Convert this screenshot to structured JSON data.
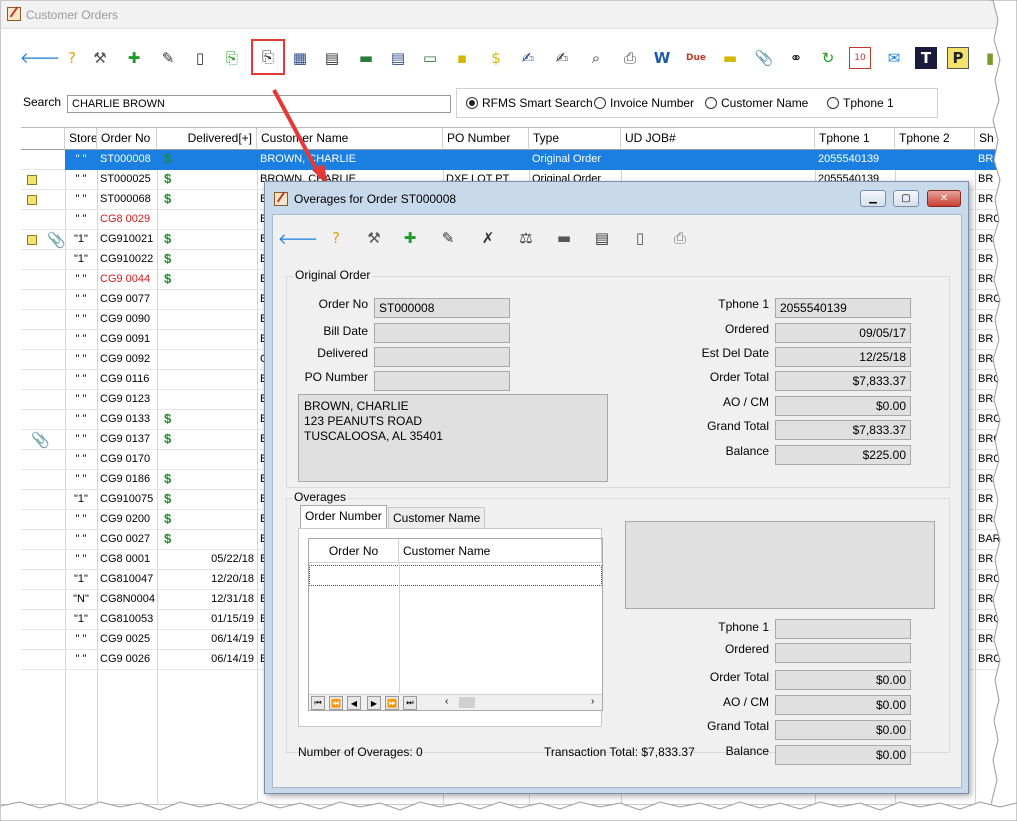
{
  "window": {
    "title": "Customer Orders"
  },
  "toolbar": {
    "items": [
      {
        "name": "back-arrow-icon",
        "glyph": "🡐",
        "color": "#1a7fe0"
      },
      {
        "name": "help-icon",
        "glyph": "?",
        "color": "#e2a400"
      },
      {
        "name": "tools-icon",
        "glyph": "⚒",
        "color": "#555555"
      },
      {
        "name": "add-document-icon",
        "glyph": "✚",
        "color": "#1e9c2a"
      },
      {
        "name": "edit-document-icon",
        "glyph": "✎",
        "color": "#333333"
      },
      {
        "name": "document-icon",
        "glyph": "▯",
        "color": "#333333"
      },
      {
        "name": "copy-add-icon",
        "glyph": "⎘",
        "color": "#1e9c2a"
      },
      {
        "name": "overages-icon",
        "glyph": "⎘",
        "color": "#333333"
      },
      {
        "name": "calculator-icon",
        "glyph": "▦",
        "color": "#2a4a8a"
      },
      {
        "name": "register-icon",
        "glyph": "▤",
        "color": "#333333"
      },
      {
        "name": "money-icon",
        "glyph": "▬",
        "color": "#2a7a3a"
      },
      {
        "name": "report-icon",
        "glyph": "▤",
        "color": "#2a4a8a"
      },
      {
        "name": "credit-card-icon",
        "glyph": "▭",
        "color": "#2a7a3a"
      },
      {
        "name": "note-icon",
        "glyph": "▪",
        "color": "#d4b800"
      },
      {
        "name": "dollar-note-icon",
        "glyph": "$",
        "color": "#d4b800"
      },
      {
        "name": "contract-icon",
        "glyph": "✍",
        "color": "#2a4a8a"
      },
      {
        "name": "signature-icon",
        "glyph": "✍",
        "color": "#333333"
      },
      {
        "name": "preview-icon",
        "glyph": "⌕",
        "color": "#333333"
      },
      {
        "name": "printer-icon",
        "glyph": "⎙",
        "color": "#555555"
      },
      {
        "name": "word-icon",
        "glyph": "W",
        "color": "#1e5aa8"
      },
      {
        "name": "due-icon",
        "glyph": "Due",
        "color": "#c0392b"
      },
      {
        "name": "ticket-icon",
        "glyph": "▬",
        "color": "#d4b800"
      },
      {
        "name": "paperclip-icon",
        "glyph": "📎",
        "color": "#555555"
      },
      {
        "name": "binoculars-icon",
        "glyph": "⚭",
        "color": "#222222"
      },
      {
        "name": "refresh-icon",
        "glyph": "↻",
        "color": "#1e9c2a"
      },
      {
        "name": "calendar-icon",
        "glyph": "10",
        "color": "#c0392b"
      },
      {
        "name": "email-icon",
        "glyph": "✉",
        "color": "#1a7fe0"
      },
      {
        "name": "t-icon",
        "glyph": "T",
        "color": "#ffffff"
      },
      {
        "name": "p-icon",
        "glyph": "P",
        "color": "#222222"
      },
      {
        "name": "book-icon",
        "glyph": "▮",
        "color": "#7a9a2a"
      }
    ]
  },
  "search": {
    "label": "Search",
    "value": "CHARLIE BROWN",
    "options": [
      {
        "label": "RFMS Smart Search",
        "selected": true
      },
      {
        "label": "Invoice Number",
        "selected": false
      },
      {
        "label": "Customer Name",
        "selected": false
      },
      {
        "label": "Tphone 1",
        "selected": false
      }
    ]
  },
  "grid": {
    "columns": [
      "Store",
      "Order No",
      "Delivered[+]",
      "Customer Name",
      "PO Number",
      "Type",
      "UD JOB#",
      "Tphone 1",
      "Tphone 2",
      "Sh"
    ],
    "rows": [
      {
        "icons": [],
        "store": "\" \"",
        "order": "ST000008",
        "dollar": "$",
        "delivered": "",
        "customer": "BROWN, CHARLIE",
        "po": "",
        "type": "Original Order",
        "tphone": "2055540139",
        "sh": "BR",
        "red": false,
        "selected": true
      },
      {
        "icons": [
          "note"
        ],
        "store": "\" \"",
        "order": "ST000025",
        "dollar": "$",
        "delivered": "",
        "customer": "BROWN, CHARLIE",
        "po": "DXF LOT PT",
        "type": "Original Order",
        "tphone": "2055540139",
        "sh": "BR",
        "red": false,
        "selected": false
      },
      {
        "icons": [
          "note"
        ],
        "store": "\" \"",
        "order": "ST000068",
        "dollar": "$",
        "delivered": "",
        "customer": "B",
        "po": "",
        "type": "",
        "tphone": "",
        "sh": "BR",
        "red": false,
        "selected": false
      },
      {
        "icons": [],
        "store": "\" \"",
        "order": "CG8 0029",
        "dollar": "",
        "delivered": "",
        "customer": "B",
        "po": "",
        "type": "",
        "tphone": "",
        "sh": "BRO",
        "red": true,
        "selected": false
      },
      {
        "icons": [
          "note",
          "clip"
        ],
        "store": "\"1\"",
        "order": "CG910021",
        "dollar": "$",
        "delivered": "",
        "customer": "B",
        "po": "",
        "type": "",
        "tphone": "",
        "sh": "BRO",
        "red": false,
        "selected": false
      },
      {
        "icons": [],
        "store": "\"1\"",
        "order": "CG910022",
        "dollar": "$",
        "delivered": "",
        "customer": "B",
        "po": "",
        "type": "",
        "tphone": "",
        "sh": "BR",
        "red": false,
        "selected": false
      },
      {
        "icons": [],
        "store": "\" \"",
        "order": "CG9 0044",
        "dollar": "$",
        "delivered": "",
        "customer": "B",
        "po": "",
        "type": "",
        "tphone": "",
        "sh": "BRO",
        "red": true,
        "selected": false
      },
      {
        "icons": [],
        "store": "\" \"",
        "order": "CG9 0077",
        "dollar": "",
        "delivered": "",
        "customer": "B",
        "po": "",
        "type": "",
        "tphone": "",
        "sh": "BRO",
        "red": false,
        "selected": false
      },
      {
        "icons": [],
        "store": "\" \"",
        "order": "CG9 0090",
        "dollar": "",
        "delivered": "",
        "customer": "B",
        "po": "",
        "type": "",
        "tphone": "",
        "sh": "BR",
        "red": false,
        "selected": false
      },
      {
        "icons": [],
        "store": "\" \"",
        "order": "CG9 0091",
        "dollar": "",
        "delivered": "",
        "customer": "B",
        "po": "",
        "type": "",
        "tphone": "",
        "sh": "BR",
        "red": false,
        "selected": false
      },
      {
        "icons": [],
        "store": "\" \"",
        "order": "CG9 0092",
        "dollar": "",
        "delivered": "",
        "customer": "C",
        "po": "",
        "type": "",
        "tphone": "",
        "sh": "BR",
        "red": false,
        "selected": false
      },
      {
        "icons": [],
        "store": "\" \"",
        "order": "CG9 0116",
        "dollar": "",
        "delivered": "",
        "customer": "B",
        "po": "",
        "type": "",
        "tphone": "",
        "sh": "BRO",
        "red": false,
        "selected": false
      },
      {
        "icons": [],
        "store": "\" \"",
        "order": "CG9 0123",
        "dollar": "",
        "delivered": "",
        "customer": "B",
        "po": "",
        "type": "",
        "tphone": "",
        "sh": "BRO",
        "red": false,
        "selected": false
      },
      {
        "icons": [],
        "store": "\" \"",
        "order": "CG9 0133",
        "dollar": "$",
        "delivered": "",
        "customer": "B",
        "po": "",
        "type": "",
        "tphone": "",
        "sh": "BRO",
        "red": false,
        "selected": false
      },
      {
        "icons": [
          "clip"
        ],
        "store": "\" \"",
        "order": "CG9 0137",
        "dollar": "$",
        "delivered": "",
        "customer": "B",
        "po": "",
        "type": "",
        "tphone": "",
        "sh": "BRO",
        "red": false,
        "selected": false
      },
      {
        "icons": [],
        "store": "\" \"",
        "order": "CG9 0170",
        "dollar": "",
        "delivered": "",
        "customer": "B",
        "po": "",
        "type": "",
        "tphone": "",
        "sh": "BRO",
        "red": false,
        "selected": false
      },
      {
        "icons": [],
        "store": "\" \"",
        "order": "CG9 0186",
        "dollar": "$",
        "delivered": "",
        "customer": "B",
        "po": "",
        "type": "",
        "tphone": "",
        "sh": "BRO",
        "red": false,
        "selected": false
      },
      {
        "icons": [],
        "store": "\"1\"",
        "order": "CG910075",
        "dollar": "$",
        "delivered": "",
        "customer": "B",
        "po": "",
        "type": "",
        "tphone": "",
        "sh": "BR",
        "red": false,
        "selected": false
      },
      {
        "icons": [],
        "store": "\" \"",
        "order": "CG9 0200",
        "dollar": "$",
        "delivered": "",
        "customer": "B",
        "po": "",
        "type": "",
        "tphone": "",
        "sh": "BRO",
        "red": false,
        "selected": false
      },
      {
        "icons": [],
        "store": "\" \"",
        "order": "CG0 0027",
        "dollar": "$",
        "delivered": "",
        "customer": "B",
        "po": "",
        "type": "",
        "tphone": "",
        "sh": "BAR",
        "red": false,
        "selected": false
      },
      {
        "icons": [],
        "store": "\" \"",
        "order": "CG8 0001",
        "dollar": "",
        "delivered": "05/22/18",
        "customer": "B",
        "po": "",
        "type": "",
        "tphone": "",
        "sh": "BR",
        "red": false,
        "selected": false
      },
      {
        "icons": [],
        "store": "\"1\"",
        "order": "CG810047",
        "dollar": "",
        "delivered": "12/20/18",
        "customer": "B",
        "po": "",
        "type": "",
        "tphone": "",
        "sh": "BRO",
        "red": false,
        "selected": false
      },
      {
        "icons": [],
        "store": "\"N\"",
        "order": "CG8N0004",
        "dollar": "",
        "delivered": "12/31/18",
        "customer": "B",
        "po": "",
        "type": "",
        "tphone": "",
        "sh": "BRO",
        "red": false,
        "selected": false
      },
      {
        "icons": [],
        "store": "\"1\"",
        "order": "CG810053",
        "dollar": "",
        "delivered": "01/15/19",
        "customer": "B",
        "po": "",
        "type": "",
        "tphone": "",
        "sh": "BRO",
        "red": false,
        "selected": false
      },
      {
        "icons": [],
        "store": "\" \"",
        "order": "CG9 0025",
        "dollar": "",
        "delivered": "06/14/19",
        "customer": "B",
        "po": "",
        "type": "",
        "tphone": "",
        "sh": "BRO",
        "red": false,
        "selected": false
      },
      {
        "icons": [],
        "store": "\" \"",
        "order": "CG9 0026",
        "dollar": "",
        "delivered": "06/14/19",
        "customer": "B",
        "po": "",
        "type": "",
        "tphone": "",
        "sh": "BRO",
        "red": false,
        "selected": false
      }
    ]
  },
  "dialog": {
    "title": "Overages for Order ST000008",
    "toolbar": [
      "back-arrow-icon",
      "help-icon",
      "tools-icon",
      "add-document-icon",
      "edit-document-icon",
      "delete-document-icon",
      "scale-icon",
      "money-icon",
      "report-icon",
      "document-icon",
      "printer-icon"
    ],
    "original_order": {
      "group_label": "Original Order",
      "order_no_label": "Order No",
      "order_no": "ST000008",
      "bill_date_label": "Bill Date",
      "bill_date": "",
      "delivered_label": "Delivered",
      "delivered": "",
      "po_number_label": "PO Number",
      "po_number": "",
      "address": [
        "BROWN, CHARLIE",
        "123 PEANUTS ROAD",
        "TUSCALOOSA, AL  35401"
      ],
      "tphone1_label": "Tphone 1",
      "tphone1": "2055540139",
      "ordered_label": "Ordered",
      "ordered": "09/05/17",
      "est_del_label": "Est Del Date",
      "est_del": "12/25/18",
      "order_total_label": "Order Total",
      "order_total": "$7,833.37",
      "ao_cm_label": "AO / CM",
      "ao_cm": "$0.00",
      "grand_total_label": "Grand Total",
      "grand_total": "$7,833.37",
      "balance_label": "Balance",
      "balance": "$225.00"
    },
    "overages": {
      "group_label": "Overages",
      "tabs": [
        {
          "label": "Order Number",
          "active": true
        },
        {
          "label": "Customer Name",
          "active": false
        }
      ],
      "columns": [
        "Order No",
        "Customer Name"
      ],
      "tphone1_label": "Tphone 1",
      "tphone1": "",
      "ordered_label": "Ordered",
      "ordered": "",
      "order_total_label": "Order Total",
      "order_total": "$0.00",
      "ao_cm_label": "AO / CM",
      "ao_cm": "$0.00",
      "grand_total_label": "Grand Total",
      "grand_total": "$0.00",
      "balance_label": "Balance",
      "balance": "$0.00",
      "count_text": "Number of Overages: 0",
      "transaction_total": "Transaction Total: $7,833.37"
    }
  }
}
